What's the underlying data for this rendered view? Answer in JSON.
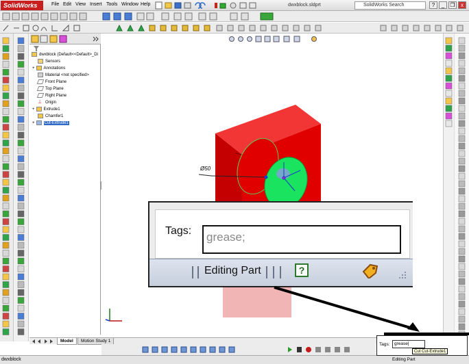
{
  "app": {
    "logo_text": "SolidWorks",
    "document_title": "dwxblock.sldprt"
  },
  "menu": [
    "File",
    "Edit",
    "View",
    "Insert",
    "Tools",
    "Window",
    "Help"
  ],
  "search": {
    "placeholder": "SolidWorks Search"
  },
  "window_controls": {
    "help": "?",
    "minimize": "_",
    "restore": "❐",
    "close": "x"
  },
  "feature_tree": {
    "root": "dwxblock  (Default<<Default>_Di",
    "items": [
      {
        "label": "Sensors",
        "icon": "sensors-icon"
      },
      {
        "label": "Annotations",
        "icon": "annotations-icon"
      },
      {
        "label": "Material <not specified>",
        "icon": "material-icon"
      },
      {
        "label": "Front Plane",
        "icon": "plane-icon"
      },
      {
        "label": "Top Plane",
        "icon": "plane-icon"
      },
      {
        "label": "Right Plane",
        "icon": "plane-icon"
      },
      {
        "label": "Origin",
        "icon": "origin-icon"
      },
      {
        "label": "Extrude1",
        "icon": "extrude-icon"
      },
      {
        "label": "Chamfer1",
        "icon": "chamfer-icon"
      },
      {
        "label": "Cut-Extrude1",
        "icon": "cut-extrude-icon",
        "selected": true
      }
    ]
  },
  "viewport": {
    "dimension_label": "Ø50"
  },
  "bottom_tabs": [
    "Model",
    "Motion Study 1"
  ],
  "tags_panel": {
    "label": "Tags:",
    "value": "grease;"
  },
  "status_bar": {
    "mode": "Editing Part",
    "document": "dwxblock",
    "help_icon": "?"
  },
  "mini_tags": {
    "label": "Tags:",
    "value": "grease|"
  },
  "tooltip": {
    "text": "Cut Cut-Extrude1"
  },
  "colors": {
    "part_red": "#e00000",
    "part_dark": "#8a0000",
    "cut_green": "#19e35f",
    "selection_blue": "#316ac5",
    "shadow_pink": "#f1b5b5"
  }
}
